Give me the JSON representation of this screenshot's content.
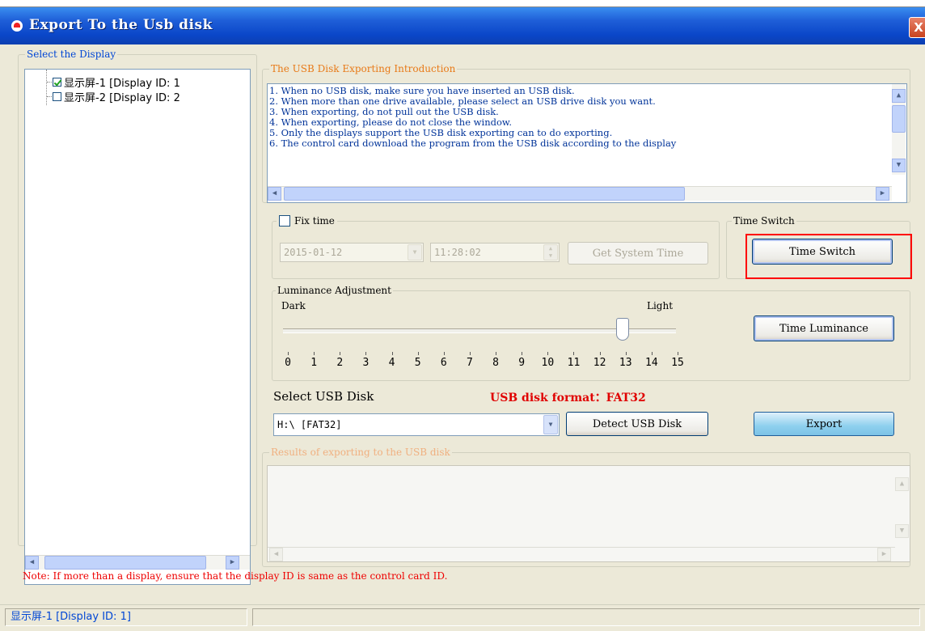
{
  "window": {
    "title": "Export To the Usb disk",
    "close_glyph": "X"
  },
  "display_panel": {
    "legend": "Select the Display",
    "items": [
      {
        "label": "显示屏-1 [Display ID: 1",
        "checked": true
      },
      {
        "label": "显示屏-2 [Display ID: 2",
        "checked": false
      }
    ]
  },
  "intro": {
    "legend": "The USB Disk Exporting Introduction",
    "lines": [
      "1. When no USB disk, make sure you have inserted an USB disk.",
      "2. When more than one drive available, please select an USB drive disk you want.",
      "3. When exporting, do not pull out the USB disk.",
      "4. When exporting, please do not close the window.",
      "5. Only the displays support the USB disk exporting can to do exporting.",
      "6. The control card download the program from the USB disk according to the display"
    ]
  },
  "fix_time": {
    "label": "Fix time",
    "checked": false,
    "date": "2015-01-12",
    "time": "11:28:02",
    "get_system_time": "Get System Time"
  },
  "time_switch": {
    "legend": "Time Switch",
    "button": "Time Switch"
  },
  "luminance": {
    "legend": "Luminance Adjustment",
    "dark_label": "Dark",
    "light_label": "Light",
    "ticks": [
      "0",
      "1",
      "2",
      "3",
      "4",
      "5",
      "6",
      "7",
      "8",
      "9",
      "10",
      "11",
      "12",
      "13",
      "14",
      "15"
    ],
    "value": 13,
    "button": "Time Luminance"
  },
  "usb": {
    "select_label": "Select USB Disk",
    "format_label": "USB disk format：FAT32",
    "selected_disk": "H:\\ [FAT32]",
    "detect_button": "Detect USB Disk",
    "export_button": "Export"
  },
  "results": {
    "legend": "Results of exporting to the USB disk"
  },
  "note": "Note: If more than a display, ensure that the display ID is same as the control card ID.",
  "status": {
    "cell1": "显示屏-1 [Display ID: 1]",
    "cell2": ""
  },
  "colors": {
    "title_bar": "#0a46c8",
    "legend_blue": "#0046d5",
    "legend_orange": "#e87a18",
    "note_red": "#e00000",
    "format_red": "#e00000"
  }
}
